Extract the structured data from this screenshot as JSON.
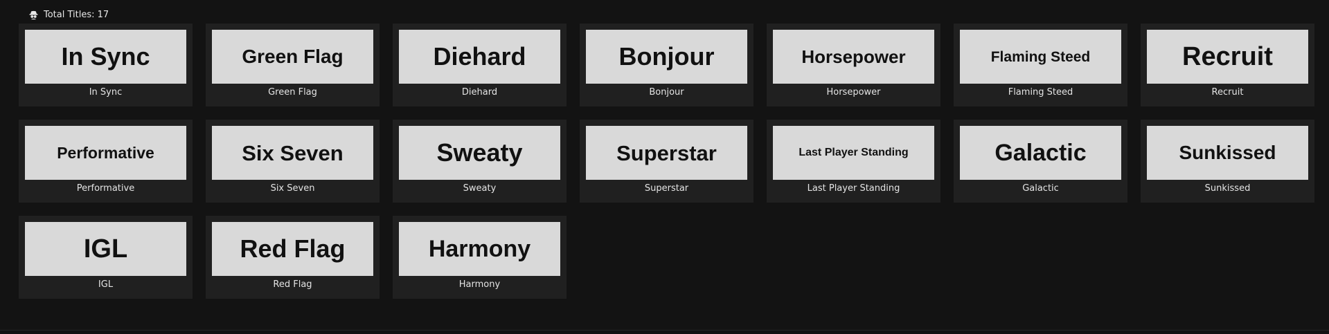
{
  "header": {
    "label": "Total Titles: 17",
    "icon": "spy-agent-icon"
  },
  "titles": [
    {
      "name": "In Sync",
      "label": "In Sync"
    },
    {
      "name": "Green Flag",
      "label": "Green Flag"
    },
    {
      "name": "Diehard",
      "label": "Diehard"
    },
    {
      "name": "Bonjour",
      "label": "Bonjour"
    },
    {
      "name": "Horsepower",
      "label": "Horsepower"
    },
    {
      "name": "Flaming Steed",
      "label": "Flaming Steed"
    },
    {
      "name": "Recruit",
      "label": "Recruit"
    },
    {
      "name": "Performative",
      "label": "Performative"
    },
    {
      "name": "Six Seven",
      "label": "Six Seven"
    },
    {
      "name": "Sweaty",
      "label": "Sweaty"
    },
    {
      "name": "Superstar",
      "label": "Superstar"
    },
    {
      "name": "Last Player Standing",
      "label": "Last Player Standing"
    },
    {
      "name": "Galactic",
      "label": "Galactic"
    },
    {
      "name": "Sunkissed",
      "label": "Sunkissed"
    },
    {
      "name": "IGL",
      "label": "IGL"
    },
    {
      "name": "Red Flag",
      "label": "Red Flag"
    },
    {
      "name": "Harmony",
      "label": "Harmony"
    }
  ]
}
